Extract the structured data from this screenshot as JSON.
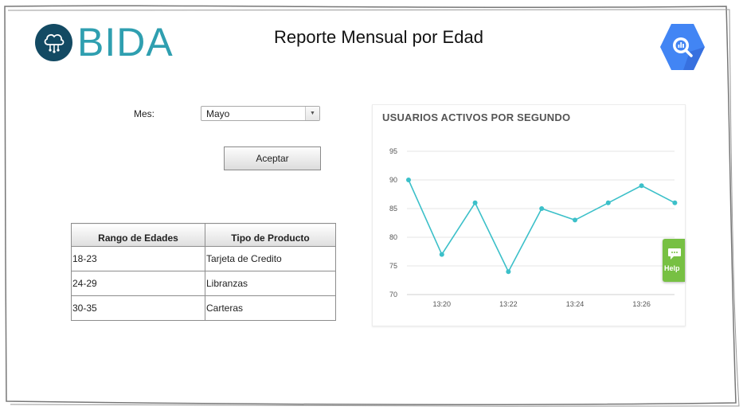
{
  "brand": {
    "logo_text": "BIDA"
  },
  "header": {
    "title": "Reporte Mensual por Edad"
  },
  "form": {
    "month_label": "Mes:",
    "month_value": "Mayo",
    "accept_label": "Aceptar"
  },
  "table": {
    "headers": [
      "Rango de Edades",
      "Tipo de Producto"
    ],
    "rows": [
      [
        "18-23",
        "Tarjeta de Credito"
      ],
      [
        "24-29",
        "Libranzas"
      ],
      [
        "30-35",
        "Carteras"
      ]
    ]
  },
  "chart_data": {
    "type": "line",
    "title": "USUARIOS ACTIVOS POR SEGUNDO",
    "xlabel": "",
    "ylabel": "",
    "ylim": [
      70,
      95
    ],
    "yticks": [
      70,
      75,
      80,
      85,
      90,
      95
    ],
    "xticks": [
      "13:20",
      "13:22",
      "13:24",
      "13:26"
    ],
    "grid": true,
    "color": "#3cc0c9",
    "series": [
      {
        "values": [
          {
            "x": "13:19",
            "y": 90
          },
          {
            "x": "13:20",
            "y": 77
          },
          {
            "x": "13:21",
            "y": 86
          },
          {
            "x": "13:22",
            "y": 74
          },
          {
            "x": "13:23",
            "y": 85
          },
          {
            "x": "13:24",
            "y": 83
          },
          {
            "x": "13:25",
            "y": 86
          },
          {
            "x": "13:26",
            "y": 89
          },
          {
            "x": "13:27",
            "y": 86
          }
        ]
      }
    ]
  },
  "help": {
    "label": "Help"
  },
  "colors": {
    "brand": "#2f9fb0",
    "brand_dark": "#134a63",
    "bigquery": "#4285f4",
    "help": "#77c043"
  }
}
